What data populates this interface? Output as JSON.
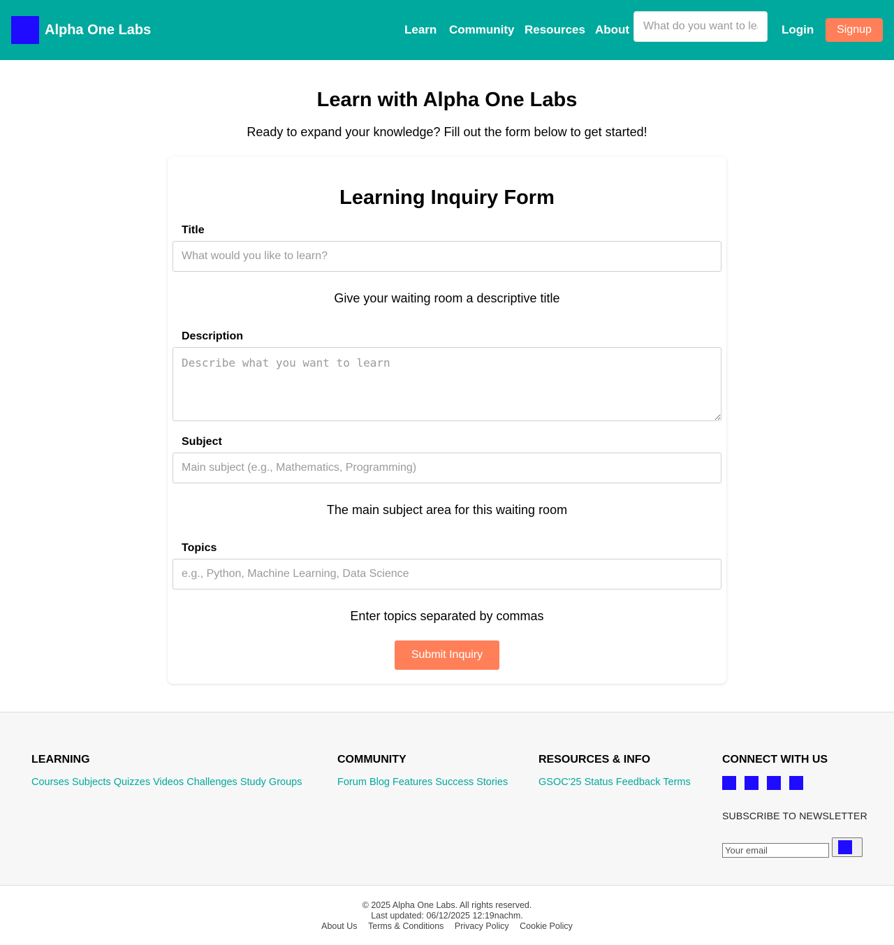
{
  "header": {
    "brand": "Alpha One Labs",
    "nav": [
      "Learn",
      "Community",
      "Resources",
      "About"
    ],
    "search_placeholder": "What do you want to learn?",
    "login": "Login",
    "signup": "Signup"
  },
  "hero": {
    "title": "Learn with Alpha One Labs",
    "subtitle": "Ready to expand your knowledge? Fill out the form below to get started!"
  },
  "form": {
    "title": "Learning Inquiry Form",
    "title_label": "Title",
    "title_placeholder": "What would you like to learn?",
    "title_help": "Give your waiting room a descriptive title",
    "description_label": "Description",
    "description_placeholder": "Describe what you want to learn",
    "subject_label": "Subject",
    "subject_placeholder": "Main subject (e.g., Mathematics, Programming)",
    "subject_help": "The main subject area for this waiting room",
    "topics_label": "Topics",
    "topics_placeholder": "e.g., Python, Machine Learning, Data Science",
    "topics_help": "Enter topics separated by commas",
    "submit": "Submit Inquiry"
  },
  "footer": {
    "learning": {
      "heading": "LEARNING",
      "links": [
        "Courses",
        "Subjects",
        "Quizzes",
        "Videos",
        "Challenges",
        "Study Groups"
      ]
    },
    "community": {
      "heading": "COMMUNITY",
      "links": [
        "Forum",
        "Blog",
        "Features",
        "Success Stories"
      ]
    },
    "resources": {
      "heading": "RESOURCES & INFO",
      "links": [
        "GSOC'25",
        "Status",
        "Feedback",
        "Terms"
      ]
    },
    "connect": {
      "heading": "CONNECT WITH US",
      "subscribe_heading": "SUBSCRIBE TO NEWSLETTER",
      "email_placeholder": "Your email"
    },
    "copyright": "© 2025 Alpha One Labs. All rights reserved.",
    "updated": "Last updated: 06/12/2025 12:19nachm.",
    "bottom_links": [
      "About Us",
      "Terms & Conditions",
      "Privacy Policy",
      "Cookie Policy"
    ]
  },
  "colors": {
    "brand_teal": "#00a99d",
    "accent_orange": "#ff7f59",
    "icon_placeholder_blue": "#1f0bff"
  }
}
